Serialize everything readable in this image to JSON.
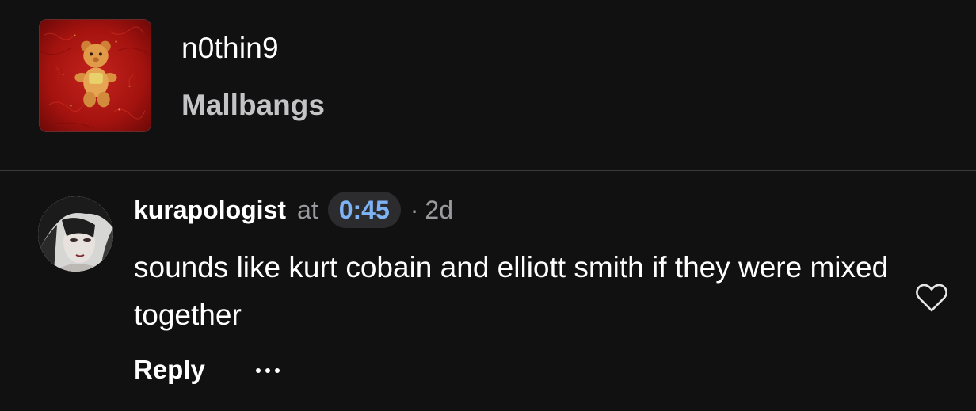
{
  "track": {
    "title": "n0thin9",
    "artist": "Mallbangs",
    "artwork_icon": "teddy-bear-artwork"
  },
  "comment": {
    "username": "kurapologist",
    "at_label": "at",
    "timestamp": "0:45",
    "separator": "·",
    "age": "2d",
    "text": "sounds like kurt cobain and elliott smith if they were mixed together",
    "reply_label": "Reply",
    "more_label": "···",
    "like_icon": "heart-outline-icon"
  },
  "colors": {
    "background": "#111112",
    "timestamp_link": "#7eb4f5",
    "chip_background": "#2c2c2e",
    "muted_text": "#9a9a9e",
    "artist_text": "#c4c4c6"
  }
}
